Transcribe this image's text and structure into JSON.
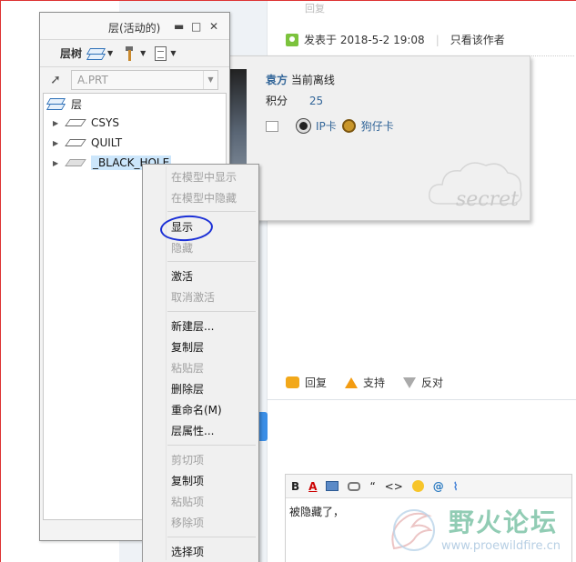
{
  "forum": {
    "old_reply": "回复",
    "post_time": "发表于 2018-5-2 19:08",
    "only_author": "只看该作者",
    "user_card": {
      "name": "袁方",
      "status": "当前离线",
      "points_label": "积分",
      "points_value": "25",
      "card1": "IP卡",
      "card2": "狗仔卡",
      "secret": "secret"
    },
    "actions": {
      "reply": "回复",
      "support": "支持",
      "oppose": "反对"
    },
    "editor_text": "被隐藏了，",
    "editor_toolbar": {
      "bold": "B",
      "color": "A",
      "quote": "“",
      "code": "<>",
      "at": "@"
    },
    "watermark_title": "野火论坛",
    "watermark_url": "www.proewildfire.cn"
  },
  "layer_window": {
    "title": "层(活动的)",
    "controls": {
      "minimize": "▬",
      "maximize": "□",
      "close": "✕"
    },
    "toolbar_label": "层树",
    "model": "A.PRT",
    "tree": {
      "root": "层",
      "items": [
        "CSYS",
        "QUILT",
        "_BLACK_HOLE"
      ]
    }
  },
  "context_menu": {
    "items": [
      {
        "label": "在模型中显示",
        "enabled": false
      },
      {
        "label": "在模型中隐藏",
        "enabled": false
      },
      {
        "label": "显示",
        "enabled": true
      },
      {
        "label": "隐藏",
        "enabled": false
      },
      {
        "label": "激活",
        "enabled": true
      },
      {
        "label": "取消激活",
        "enabled": false
      },
      {
        "label": "新建层...",
        "enabled": true
      },
      {
        "label": "复制层",
        "enabled": true
      },
      {
        "label": "粘贴层",
        "enabled": false
      },
      {
        "label": "删除层",
        "enabled": true
      },
      {
        "label": "重命名(M)",
        "enabled": true
      },
      {
        "label": "层属性...",
        "enabled": true
      },
      {
        "label": "剪切项",
        "enabled": false
      },
      {
        "label": "复制项",
        "enabled": true
      },
      {
        "label": "粘贴项",
        "enabled": false
      },
      {
        "label": "移除项",
        "enabled": false
      },
      {
        "label": "选择项",
        "enabled": true
      }
    ]
  },
  "colors": {
    "annotation_circle": "#1a2fd6",
    "selection": "#cce6fb",
    "link_blue": "#336699"
  }
}
